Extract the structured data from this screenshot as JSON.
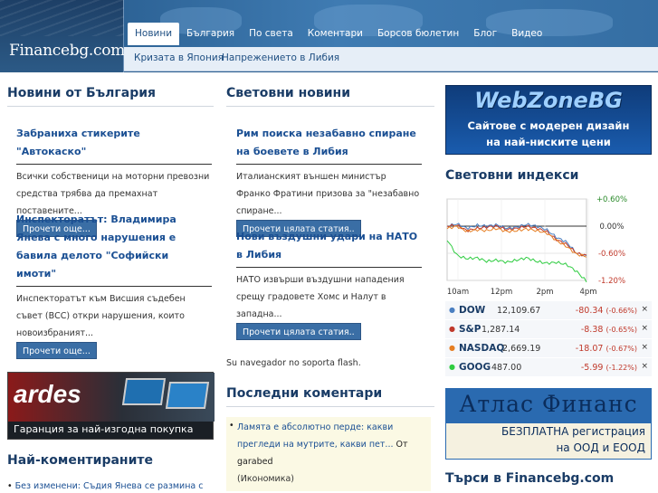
{
  "header": {
    "logo_text": "Financebg.com",
    "nav": [
      "Новини",
      "България",
      "По света",
      "Коментари",
      "Борсов бюлетин",
      "Блог",
      "Видео"
    ],
    "active_nav": 0,
    "subnav": [
      "Кризата в Япония",
      "Напрежението в Либия"
    ]
  },
  "col1": {
    "title_bold": "Новини",
    "title_rest": " от България",
    "articles": [
      {
        "title": "Забраниха стикерите \"Автокаско\"",
        "text": "Всички собственици на моторни превозни средства трябва да премахнат поставените...",
        "button": "Прочети още..."
      },
      {
        "title": "Инспекторатът: Владимира Янева с много нарушения е бавила делото \"Софийски имоти\"",
        "text": " Инспекторатът към Висшия съдебен съвет (ВСС) откри нарушения, които новоизбраният...",
        "button": "Прочети още..."
      }
    ],
    "banner": {
      "brand": "ardes",
      "slogan": "Гаранция за най-изгодна покупка"
    },
    "most_commented_title": "Най-коментираните",
    "most_commented_first": "Без изменени: Съдия Янева се размина с"
  },
  "col2": {
    "title": "Световни новини",
    "articles": [
      {
        "title": "Рим поиска незабавно спиране на боевете в Либия",
        "text": " Италианският външен министър Франко Фратини призова за \"незабавно спиране...",
        "button": "Прочети цялата статия.."
      },
      {
        "title": "Нови въздушни удари на НАТО в Либия",
        "text": "НАТО извърши въздушни нападения срещу градовете Хомс и Налут в западна...",
        "button": "Прочети цялата статия.."
      }
    ],
    "flash_notice": "Su navegador no soporta flash.",
    "comments_title": "Последни коментари",
    "comments": [
      {
        "link": "Ламята е абсолютно перде: какви прегледи на мутрите, какви пет...",
        "from": " От",
        "author": "garabed",
        "category": "(Икономика)"
      }
    ]
  },
  "col3": {
    "banner_webzone": {
      "brand": "WebZoneBG",
      "line1": "Сайтове с модерен дизайн",
      "line2": "на най-ниските цени"
    },
    "indexes_title": "Световни индекси",
    "chart_data": {
      "type": "line",
      "x_ticks": [
        "10am",
        "12pm",
        "2pm",
        "4pm"
      ],
      "y_ticks": [
        "+0.60%",
        "0.00%",
        "-0.60%",
        "-1.20%"
      ],
      "ylim": [
        -1.2,
        0.6
      ],
      "series": [
        {
          "name": "DOW",
          "color": "#4a7fc1",
          "values": [
            0.0,
            0.05,
            -0.05,
            0.02,
            0.0,
            0.03,
            -0.05,
            -0.02,
            0.04,
            0.0,
            -0.08,
            -0.25,
            -0.35,
            -0.6,
            -0.66
          ]
        },
        {
          "name": "S&P",
          "color": "#c0392b",
          "values": [
            0.0,
            0.02,
            -0.1,
            -0.05,
            -0.02,
            0.0,
            -0.08,
            -0.05,
            0.0,
            -0.05,
            -0.12,
            -0.3,
            -0.4,
            -0.6,
            -0.65
          ]
        },
        {
          "name": "NASDAQ",
          "color": "#e67e22",
          "values": [
            -0.05,
            0.0,
            -0.12,
            -0.08,
            -0.1,
            -0.05,
            -0.12,
            -0.1,
            -0.06,
            -0.1,
            -0.15,
            -0.32,
            -0.45,
            -0.62,
            -0.67
          ]
        },
        {
          "name": "GOOG",
          "color": "#2ecc40",
          "values": [
            -0.3,
            -0.65,
            -0.72,
            -0.7,
            -0.78,
            -0.75,
            -0.8,
            -0.75,
            -0.7,
            -0.78,
            -0.82,
            -0.8,
            -0.85,
            -1.0,
            -1.22
          ]
        }
      ]
    },
    "indexes": [
      {
        "name": "DOW",
        "value": "12,109.67",
        "change": "-80.34",
        "pct": "(-0.66%)",
        "color": "#4a7fc1"
      },
      {
        "name": "S&P",
        "value": "1,287.14",
        "change": "-8.38",
        "pct": "(-0.65%)",
        "color": "#c0392b"
      },
      {
        "name": "NASDAQ",
        "value": "2,669.19",
        "change": "-18.07",
        "pct": "(-0.67%)",
        "color": "#e67e22"
      },
      {
        "name": "GOOG",
        "value": "487.00",
        "change": "-5.99",
        "pct": "(-1.22%)",
        "color": "#2ecc40"
      }
    ],
    "close_symbol": "×",
    "banner_atlas": {
      "brand": "Атлас Финанс",
      "line1": "БЕЗПЛАТНА  регистрация",
      "line2": "на ООД и ЕООД"
    },
    "search_title_bold": "Търси",
    "search_title_rest": " в Financebg.com"
  }
}
